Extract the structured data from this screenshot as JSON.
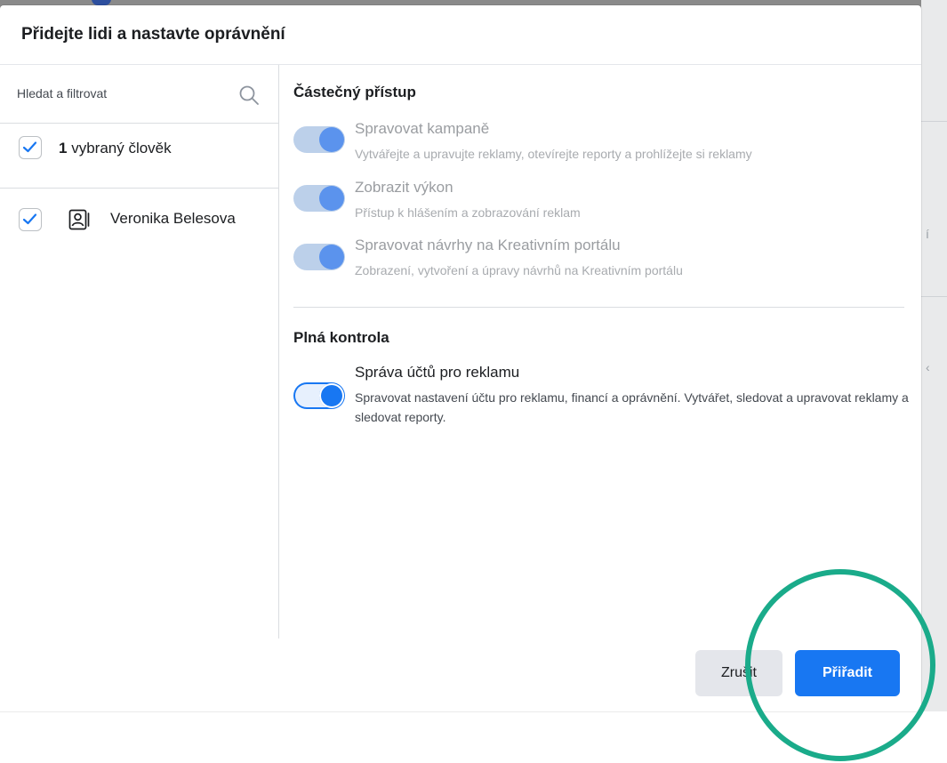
{
  "dialog": {
    "title": "Přidejte lidi a nastavte oprávnění"
  },
  "search": {
    "placeholder": "Hledat a filtrovat",
    "value": ""
  },
  "selection": {
    "count": "1",
    "label": "vybraný člověk",
    "checked": true
  },
  "people": [
    {
      "name": "Veronika Belesova",
      "checked": true
    }
  ],
  "partial_access": {
    "title": "Částečný přístup",
    "permissions": [
      {
        "title": "Spravovat kampaně",
        "description": "Vytvářejte a upravujte reklamy, otevírejte reporty a prohlížejte si reklamy",
        "enabled": true,
        "disabled": true
      },
      {
        "title": "Zobrazit výkon",
        "description": "Přístup k hlášením a zobrazování reklam",
        "enabled": true,
        "disabled": true
      },
      {
        "title": "Spravovat návrhy na Kreativním portálu",
        "description": "Zobrazení, vytvoření a úpravy návrhů na Kreativním portálu",
        "enabled": true,
        "disabled": true
      }
    ]
  },
  "full_control": {
    "title": "Plná kontrola",
    "permissions": [
      {
        "title": "Správa účtů pro reklamu",
        "description": "Spravovat nastavení účtu pro reklamu, financí a oprávnění. Vytvářet, sledovat a upravovat reklamy a sledovat reporty.",
        "enabled": true,
        "disabled": false
      }
    ]
  },
  "footer": {
    "cancel_label": "Zrušit",
    "assign_label": "Přiřadit"
  },
  "colors": {
    "primary": "#1877f2",
    "highlight_ring": "#1aab8a"
  },
  "icons": [
    "search-icon",
    "checkmark-icon",
    "person-card-icon"
  ]
}
